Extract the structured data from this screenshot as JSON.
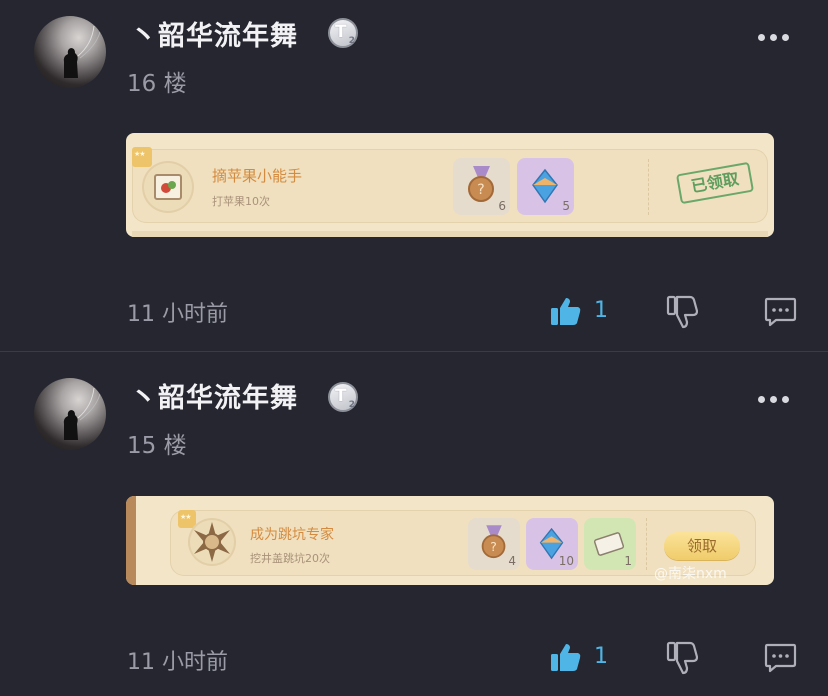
{
  "posts": [
    {
      "username": "丶韶华流年舞",
      "level_badge": "T",
      "level_num": "2",
      "floor": "16 楼",
      "card": {
        "task_title": "摘苹果小能手",
        "task_desc": "打苹果10次",
        "rewards": [
          {
            "icon": "medal-icon",
            "count": "6"
          },
          {
            "icon": "gem-icon",
            "count": "5"
          }
        ],
        "status": "已领取"
      },
      "time": "11 小时前",
      "likes": "1"
    },
    {
      "username": "丶韶华流年舞",
      "level_badge": "T",
      "level_num": "2",
      "floor": "15 楼",
      "card": {
        "task_title": "成为跳坑专家",
        "task_desc": "挖井盖跳坑20次",
        "rewards": [
          {
            "icon": "medal-icon",
            "count": "4"
          },
          {
            "icon": "gem-icon",
            "count": "10"
          },
          {
            "icon": "ticket-icon",
            "count": "1"
          }
        ],
        "status": "领取"
      },
      "time": "11 小时前",
      "likes": "1"
    }
  ],
  "watermark": "@南柒nxm",
  "colors": {
    "background": "#25262f",
    "like_accent": "#4fb5e6",
    "task_title": "#d58b3f",
    "claimed_stamp": "#5f9e5e"
  }
}
